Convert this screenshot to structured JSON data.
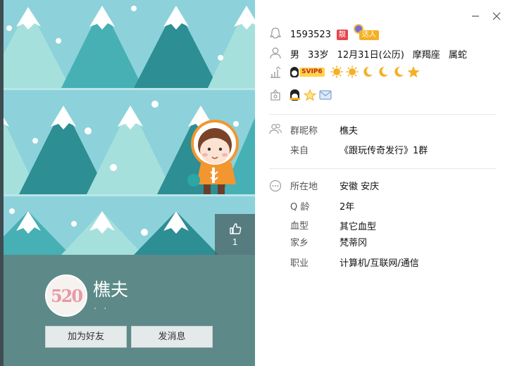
{
  "window": {
    "close_icon": "close-icon",
    "minimize_icon": "minimize-icon"
  },
  "profile": {
    "nickname": "樵夫",
    "signature": ". .",
    "avatar_text": "520",
    "likes": "1",
    "add_friend_label": "加为好友",
    "send_message_label": "发消息"
  },
  "info": {
    "qq_number": "1593523",
    "pretty_badge": "靓",
    "expert_badge": "达人",
    "gender": "男",
    "age": "33岁",
    "birthday": "12月31日(公历)",
    "zodiac": "摩羯座",
    "chinese_zodiac": "属蛇",
    "svip_label": "SVIP6"
  },
  "group": {
    "nick_label": "群昵称",
    "nick_value": "樵夫",
    "from_label": "来自",
    "from_value": "《跟玩传奇发行》1群"
  },
  "details": {
    "location_label": "所在地",
    "location_value": "安徽 安庆",
    "qage_label": "Q 龄",
    "qage_value": "2年",
    "blood_label": "血型",
    "blood_value": "其它血型",
    "hometown_label": "家乡",
    "hometown_value": "梵蒂冈",
    "job_label": "职业",
    "job_value": "计算机/互联网/通信"
  },
  "colors": {
    "sky": "#8dd2da",
    "tree_light": "#a6e0dc",
    "tree_mid": "#46b0b5",
    "tree_dark": "#2d8e93",
    "panel": "#5d8a88",
    "orange": "#f29630",
    "sun": "#f5b025"
  }
}
